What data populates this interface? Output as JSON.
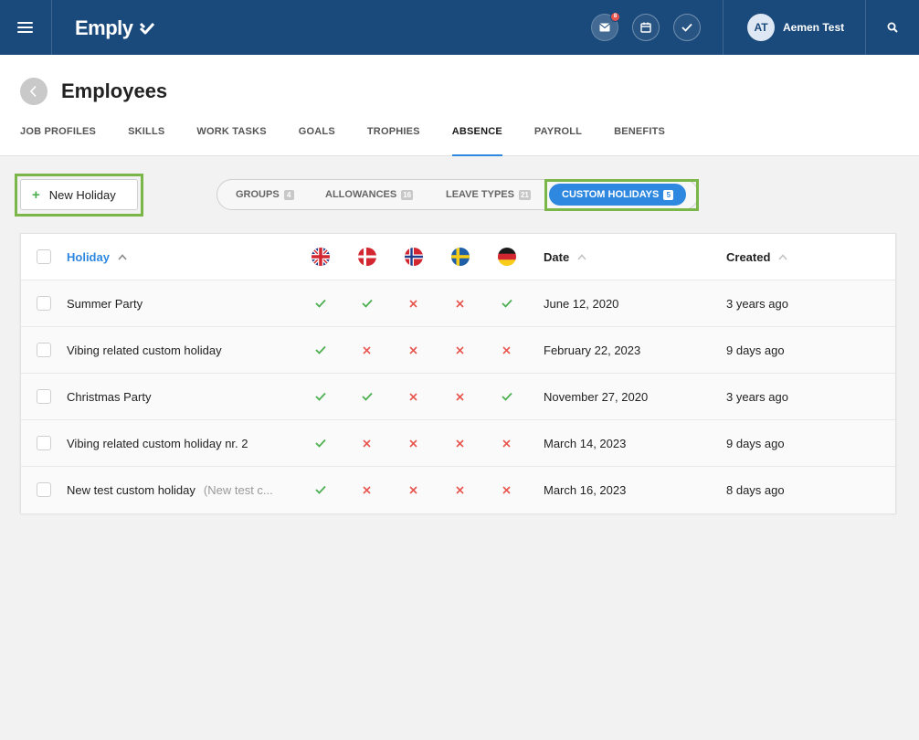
{
  "topbar": {
    "logo": "Emply",
    "mail_badge": "8",
    "user_initials": "AT",
    "user_name": "Aemen Test"
  },
  "page": {
    "title": "Employees",
    "tabs": [
      "JOB PROFILES",
      "SKILLS",
      "WORK TASKS",
      "GOALS",
      "TROPHIES",
      "ABSENCE",
      "PAYROLL",
      "BENEFITS"
    ],
    "active_tab": "ABSENCE"
  },
  "actions": {
    "new_holiday_label": "New Holiday"
  },
  "segments": [
    {
      "label": "GROUPS",
      "count": "4"
    },
    {
      "label": "ALLOWANCES",
      "count": "16"
    },
    {
      "label": "LEAVE TYPES",
      "count": "21"
    },
    {
      "label": "CUSTOM HOLIDAYS",
      "count": "5",
      "active": true
    }
  ],
  "table": {
    "columns": {
      "holiday": "Holiday",
      "date": "Date",
      "created": "Created"
    },
    "countries": [
      "uk",
      "denmark",
      "norway",
      "sweden",
      "germany"
    ],
    "rows": [
      {
        "name": "Summer Party",
        "note": "",
        "marks": [
          true,
          true,
          false,
          false,
          true
        ],
        "date": "June 12, 2020",
        "created": "3 years ago"
      },
      {
        "name": "Vibing related custom holiday",
        "note": "",
        "marks": [
          true,
          false,
          false,
          false,
          false
        ],
        "date": "February 22, 2023",
        "created": "9 days ago"
      },
      {
        "name": "Christmas Party",
        "note": "",
        "marks": [
          true,
          true,
          false,
          false,
          true
        ],
        "date": "November 27, 2020",
        "created": "3 years ago"
      },
      {
        "name": "Vibing related custom holiday nr. 2",
        "note": "",
        "marks": [
          true,
          false,
          false,
          false,
          false
        ],
        "date": "March 14, 2023",
        "created": "9 days ago"
      },
      {
        "name": "New test custom holiday",
        "note": "(New test c...",
        "marks": [
          true,
          false,
          false,
          false,
          false
        ],
        "date": "March 16, 2023",
        "created": "8 days ago"
      }
    ]
  },
  "colors": {
    "topbar": "#1a4a7c",
    "accent": "#2f88e0",
    "highlight": "#7ab648",
    "check": "#4caf50",
    "cross": "#e8544e"
  }
}
